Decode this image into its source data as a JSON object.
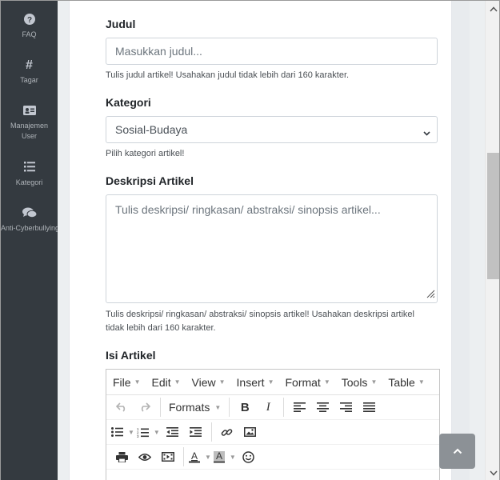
{
  "sidebar": {
    "items": [
      {
        "label": "FAQ",
        "icon": "question-circle-icon"
      },
      {
        "label": "Tagar",
        "icon": "hashtag-icon"
      },
      {
        "label": "Manajemen User",
        "line1": "Manajemen",
        "line2": "User",
        "icon": "id-card-icon"
      },
      {
        "label": "Kategori",
        "icon": "list-icon"
      },
      {
        "label": "Anti-Cyberbullying",
        "icon": "comments-icon"
      }
    ]
  },
  "form": {
    "judul": {
      "label": "Judul",
      "placeholder": "Masukkan judul...",
      "help": "Tulis judul artikel! Usahakan judul tidak lebih dari 160 karakter."
    },
    "kategori": {
      "label": "Kategori",
      "selected": "Sosial-Budaya",
      "help": "Pilih kategori artikel!"
    },
    "deskripsi": {
      "label": "Deskripsi Artikel",
      "placeholder": "Tulis deskripsi/ ringkasan/ abstraksi/ sinopsis artikel...",
      "help_line1": "Tulis deskripsi/ ringkasan/ abstraksi/ sinopsis artikel! Usahakan deskripsi artikel",
      "help_line2": "tidak lebih dari 160 karakter."
    },
    "isi": {
      "label": "Isi Artikel"
    }
  },
  "editor": {
    "menus": [
      "File",
      "Edit",
      "View",
      "Insert",
      "Format",
      "Tools",
      "Table"
    ],
    "formats_label": "Formats"
  },
  "colors": {
    "sidebar_bg": "#343a40",
    "page_bg": "#eceff1",
    "to_top_button": "#8c9196"
  }
}
